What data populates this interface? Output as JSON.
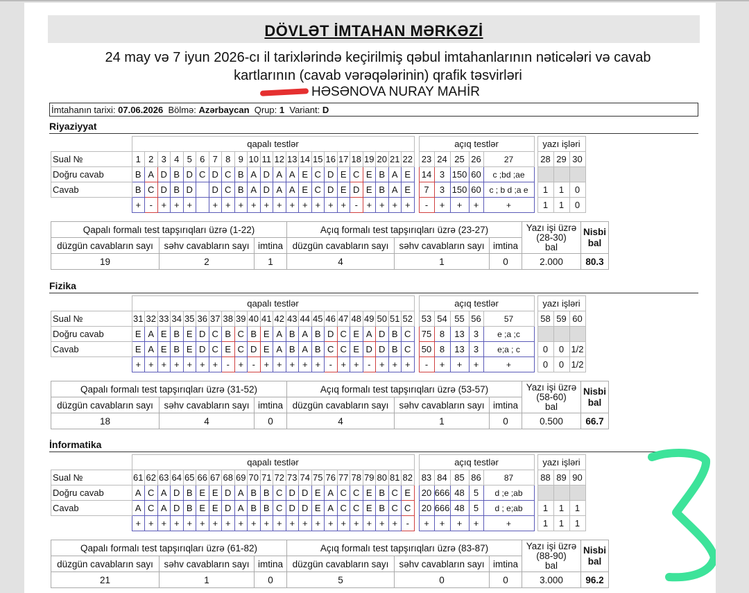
{
  "header": {
    "title": "DÖVLƏT İMTAHAN MƏRKƏZİ",
    "subtitle_line1": "24 may və 7 iyun 2026-cı il tarixlərində keçirilmiş qəbul imtahanlarının nəticələri və cavab",
    "subtitle_line2": "kartlarının (cavab vərəqələrinin) qrafik təsvirləri",
    "candidate_name": "HƏSƏNOVA NURAY MAHİR"
  },
  "exam_info": {
    "date_label": "İmtahanın tarixi:",
    "date": "07.06.2026",
    "section_label": "Bölmə:",
    "section": "Azərbaycan",
    "group_label": "Qrup:",
    "group": "1",
    "variant_label": "Variant:",
    "variant": "D"
  },
  "labels": {
    "closed": "qapalı testlər",
    "open": "açıq testlər",
    "written": "yazı işləri",
    "question_no": "Sual №",
    "correct_answer": "Doğru cavab",
    "answer": "Cavab",
    "correct_count": "düzgün cavabların sayı",
    "wrong_count": "səhv cavabların sayı",
    "skipped": "imtina",
    "relative": "Nisbi",
    "relative2": "bal",
    "points": "bal"
  },
  "subjects": [
    {
      "name": "Riyaziyyat",
      "closed_nums": [
        "1",
        "2",
        "3",
        "4",
        "5",
        "6",
        "7",
        "8",
        "9",
        "10",
        "11",
        "12",
        "13",
        "14",
        "15",
        "16",
        "17",
        "18",
        "19",
        "20",
        "21",
        "22"
      ],
      "closed_correct": [
        "B",
        "A",
        "D",
        "B",
        "D",
        "C",
        "D",
        "C",
        "B",
        "A",
        "D",
        "A",
        "A",
        "E",
        "C",
        "D",
        "E",
        "C",
        "E",
        "B",
        "A",
        "E"
      ],
      "closed_answer": [
        "B",
        "C",
        "D",
        "B",
        "D",
        "",
        "D",
        "C",
        "B",
        "A",
        "D",
        "A",
        "A",
        "E",
        "C",
        "D",
        "E",
        "D",
        "E",
        "B",
        "A",
        "E"
      ],
      "closed_mark": [
        "+",
        "-",
        "+",
        "+",
        "+",
        "",
        "+",
        "+",
        "+",
        "+",
        "+",
        "+",
        "+",
        "+",
        "+",
        "+",
        "+",
        "-",
        "+",
        "+",
        "+",
        "+"
      ],
      "open_nums": [
        "23",
        "24",
        "25",
        "26",
        "27"
      ],
      "open_correct": [
        "14",
        "3",
        "150",
        "60",
        "c ;bd ;ae"
      ],
      "open_answer": [
        "7",
        "3",
        "150",
        "60",
        "c ; b d ;a e"
      ],
      "open_mark": [
        "-",
        "+",
        "+",
        "+",
        "+"
      ],
      "written_nums": [
        "28",
        "29",
        "30"
      ],
      "written_answer": [
        "1",
        "1",
        "0"
      ],
      "written_mark": [
        "1",
        "1",
        "0"
      ],
      "closed_summary_title": "Qapalı formalı test tapşırıqları üzrə (1-22)",
      "open_summary_title": "Açıq formalı test tapşırıqları üzrə (23-27)",
      "written_summary_title": "Yazı işi üzrə",
      "written_range": "(28-30)",
      "closed_correct_count": "19",
      "closed_wrong_count": "2",
      "closed_skipped": "1",
      "open_correct_count": "4",
      "open_wrong_count": "1",
      "open_skipped": "0",
      "written_points": "2.000",
      "relative_score": "80.3"
    },
    {
      "name": "Fizika",
      "closed_nums": [
        "31",
        "32",
        "33",
        "34",
        "35",
        "36",
        "37",
        "38",
        "39",
        "40",
        "41",
        "42",
        "43",
        "44",
        "45",
        "46",
        "47",
        "48",
        "49",
        "50",
        "51",
        "52"
      ],
      "closed_correct": [
        "E",
        "A",
        "E",
        "B",
        "E",
        "D",
        "C",
        "B",
        "C",
        "B",
        "E",
        "A",
        "B",
        "A",
        "B",
        "D",
        "C",
        "E",
        "A",
        "D",
        "B",
        "C"
      ],
      "closed_answer": [
        "E",
        "A",
        "E",
        "B",
        "E",
        "D",
        "C",
        "E",
        "C",
        "D",
        "E",
        "A",
        "B",
        "A",
        "B",
        "C",
        "C",
        "E",
        "D",
        "D",
        "B",
        "C"
      ],
      "closed_mark": [
        "+",
        "+",
        "+",
        "+",
        "+",
        "+",
        "+",
        "-",
        "+",
        "-",
        "+",
        "+",
        "+",
        "+",
        "+",
        "-",
        "+",
        "+",
        "-",
        "+",
        "+",
        "+"
      ],
      "open_nums": [
        "53",
        "54",
        "55",
        "56",
        "57"
      ],
      "open_correct": [
        "75",
        "8",
        "13",
        "3",
        "e ;a ;c"
      ],
      "open_answer": [
        "50",
        "8",
        "13",
        "3",
        "e;a ; c"
      ],
      "open_mark": [
        "-",
        "+",
        "+",
        "+",
        "+"
      ],
      "written_nums": [
        "58",
        "59",
        "60"
      ],
      "written_answer": [
        "0",
        "0",
        "1/2"
      ],
      "written_mark": [
        "0",
        "0",
        "1/2"
      ],
      "closed_summary_title": "Qapalı formalı test tapşırıqları üzrə (31-52)",
      "open_summary_title": "Açıq formalı test tapşırıqları üzrə (53-57)",
      "written_summary_title": "Yazı işi üzrə",
      "written_range": "(58-60)",
      "closed_correct_count": "18",
      "closed_wrong_count": "4",
      "closed_skipped": "0",
      "open_correct_count": "4",
      "open_wrong_count": "1",
      "open_skipped": "0",
      "written_points": "0.500",
      "relative_score": "66.7"
    },
    {
      "name": "İnformatika",
      "closed_nums": [
        "61",
        "62",
        "63",
        "64",
        "65",
        "66",
        "67",
        "68",
        "69",
        "70",
        "71",
        "72",
        "73",
        "74",
        "75",
        "76",
        "77",
        "78",
        "79",
        "80",
        "81",
        "82"
      ],
      "closed_correct": [
        "A",
        "C",
        "A",
        "D",
        "B",
        "E",
        "E",
        "D",
        "A",
        "B",
        "B",
        "C",
        "D",
        "D",
        "E",
        "A",
        "C",
        "C",
        "E",
        "B",
        "C",
        "E"
      ],
      "closed_answer": [
        "A",
        "C",
        "A",
        "D",
        "B",
        "E",
        "E",
        "D",
        "A",
        "B",
        "B",
        "C",
        "D",
        "D",
        "E",
        "A",
        "C",
        "C",
        "E",
        "B",
        "C",
        "C"
      ],
      "closed_mark": [
        "+",
        "+",
        "+",
        "+",
        "+",
        "+",
        "+",
        "+",
        "+",
        "+",
        "+",
        "+",
        "+",
        "+",
        "+",
        "+",
        "+",
        "+",
        "+",
        "+",
        "+",
        "-"
      ],
      "open_nums": [
        "83",
        "84",
        "85",
        "86",
        "87"
      ],
      "open_correct": [
        "20",
        "666",
        "48",
        "5",
        "d ;e ;ab"
      ],
      "open_answer": [
        "20",
        "666",
        "48",
        "5",
        "d ; e;ab"
      ],
      "open_mark": [
        "+",
        "+",
        "+",
        "+",
        "+"
      ],
      "written_nums": [
        "88",
        "89",
        "90"
      ],
      "written_answer": [
        "1",
        "1",
        "1"
      ],
      "written_mark": [
        "1",
        "1",
        "1"
      ],
      "closed_summary_title": "Qapalı formalı test tapşırıqları üzrə (61-82)",
      "open_summary_title": "Açıq formalı test tapşırıqları üzrə (83-87)",
      "written_summary_title": "Yazı işi üzrə",
      "written_range": "(88-90)",
      "closed_correct_count": "21",
      "closed_wrong_count": "1",
      "closed_skipped": "0",
      "open_correct_count": "5",
      "open_wrong_count": "0",
      "open_skipped": "0",
      "written_points": "3.000",
      "relative_score": "96.2"
    }
  ],
  "colors": {
    "answer_border": "#5b5bb8",
    "wrong_border": "#d04040",
    "annotation": "#3de39a"
  }
}
